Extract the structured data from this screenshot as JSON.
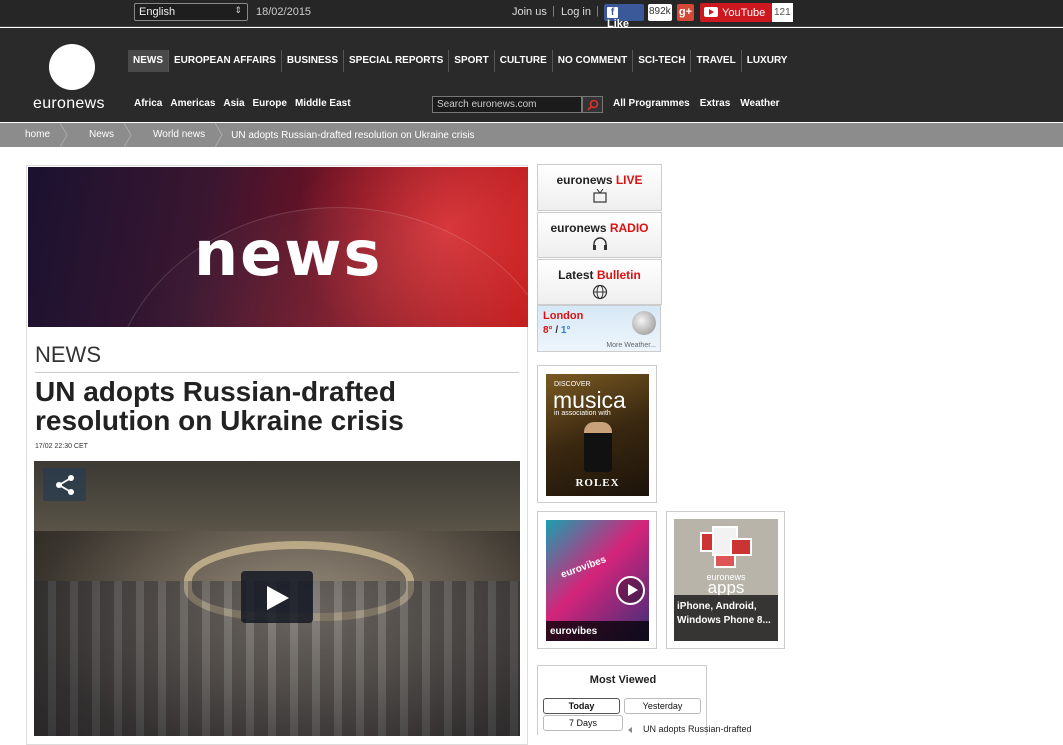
{
  "topbar": {
    "language": "English",
    "date": "18/02/2015",
    "join_us": "Join us",
    "log_in": "Log in",
    "facebook_like": "Like",
    "facebook_count": "892k",
    "gplus": "g+",
    "youtube_label": "YouTube",
    "youtube_count": "121"
  },
  "header": {
    "logo_text": "euronews",
    "main_nav": [
      "NEWS",
      "EUROPEAN AFFAIRS",
      "BUSINESS",
      "SPECIAL REPORTS",
      "SPORT",
      "CULTURE",
      "NO COMMENT",
      "SCI-TECH",
      "TRAVEL",
      "LUXURY"
    ],
    "active_nav": "NEWS",
    "regions": [
      "Africa",
      "Americas",
      "Asia",
      "Europe",
      "Middle East"
    ],
    "search_placeholder": "Search euronews.com",
    "extra_links": [
      "All Programmes",
      "Extras",
      "Weather"
    ]
  },
  "breadcrumb": {
    "items": [
      "home",
      "News",
      "World news"
    ],
    "current": "UN adopts Russian-drafted resolution on Ukraine crisis"
  },
  "article": {
    "banner_word": "news",
    "section": "NEWS",
    "headline": "UN adopts Russian-drafted resolution on Ukraine crisis",
    "timestamp": "17/02 22:30 CET"
  },
  "sidebar": {
    "live": {
      "brand": "euronews",
      "accent": "LIVE"
    },
    "radio": {
      "brand": "euronews",
      "accent": "RADIO"
    },
    "bulletin": {
      "brand": "Latest",
      "accent": "Bulletin"
    },
    "weather": {
      "city": "London",
      "high": "8°",
      "low": "1°",
      "more": "More Weather..."
    },
    "ad_musica": {
      "discover": "DISCOVER",
      "title": "musica",
      "assoc": "in association with",
      "sponsor": "ROLEX"
    },
    "eurovibes": {
      "logo": "eurovibes",
      "caption": "eurovibes"
    },
    "apps": {
      "brand": "euronews",
      "title": "apps",
      "caption": "iPhone, Android, Windows Phone 8..."
    },
    "most_viewed": {
      "title": "Most Viewed",
      "tabs": [
        "Today",
        "Yesterday",
        "7 Days"
      ],
      "active_tab": "Today",
      "first_item": "UN adopts Russian-drafted"
    }
  },
  "colors": {
    "accent_red": "#dd1111",
    "header_bg": "#2a2a2a",
    "breadcrumb_bg": "#8c8c8c"
  }
}
